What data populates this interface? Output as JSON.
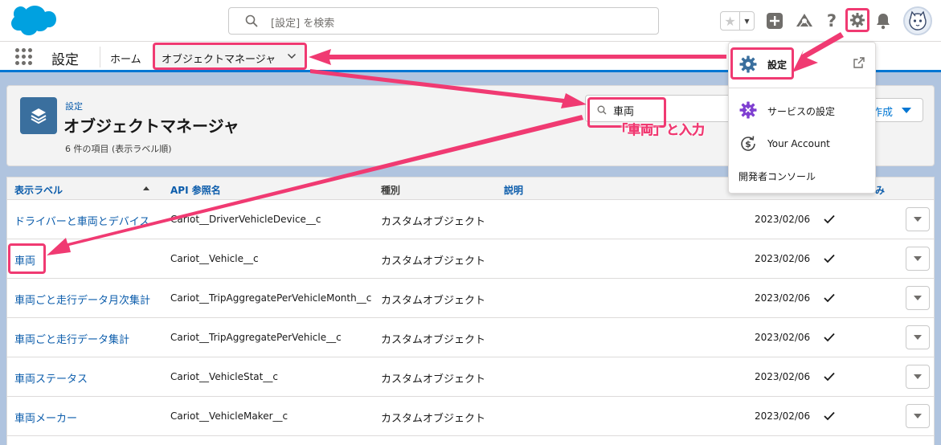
{
  "header": {
    "search_placeholder": "[設定] を検索"
  },
  "context_bar": {
    "app_name": "設定",
    "nav_home": "ホーム",
    "nav_object_manager": "オブジェクトマネージャ"
  },
  "page_header": {
    "eyebrow": "設定",
    "title": "オブジェクトマネージャ",
    "meta": "6 件の項目 (表示ラベル順)",
    "search_value": "車両",
    "new_button_partial": "作成"
  },
  "annotation": {
    "callout": "「車両」と入力"
  },
  "table": {
    "columns": {
      "label": "表示ラベル",
      "api": "API 参照名",
      "type": "種別",
      "description": "説明",
      "deployed_partial": "み"
    },
    "rows": [
      {
        "label": "ドライバーと車両とデバイス",
        "api": "Cariot__DriverVehicleDevice__c",
        "type": "カスタムオブジェクト",
        "date": "2023/02/06"
      },
      {
        "label": "車両",
        "api": "Cariot__Vehicle__c",
        "type": "カスタムオブジェクト",
        "date": "2023/02/06"
      },
      {
        "label": "車両ごと走行データ月次集計",
        "api": "Cariot__TripAggregatePerVehicleMonth__c",
        "type": "カスタムオブジェクト",
        "date": "2023/02/06"
      },
      {
        "label": "車両ごと走行データ集計",
        "api": "Cariot__TripAggregatePerVehicle__c",
        "type": "カスタムオブジェクト",
        "date": "2023/02/06"
      },
      {
        "label": "車両ステータス",
        "api": "Cariot__VehicleStat__c",
        "type": "カスタムオブジェクト",
        "date": "2023/02/06"
      },
      {
        "label": "車両メーカー",
        "api": "Cariot__VehicleMaker__c",
        "type": "カスタムオブジェクト",
        "date": "2023/02/06"
      }
    ]
  },
  "setup_menu": {
    "setup": "設定",
    "service_setup": "サービスの設定",
    "your_account": "Your Account",
    "developer_console": "開発者コンソール"
  },
  "colors": {
    "brand_blue": "#0176d3",
    "link_blue": "#0b5cab",
    "highlight_pink": "#f03a72",
    "setup_purple": "#7f3fd1"
  }
}
